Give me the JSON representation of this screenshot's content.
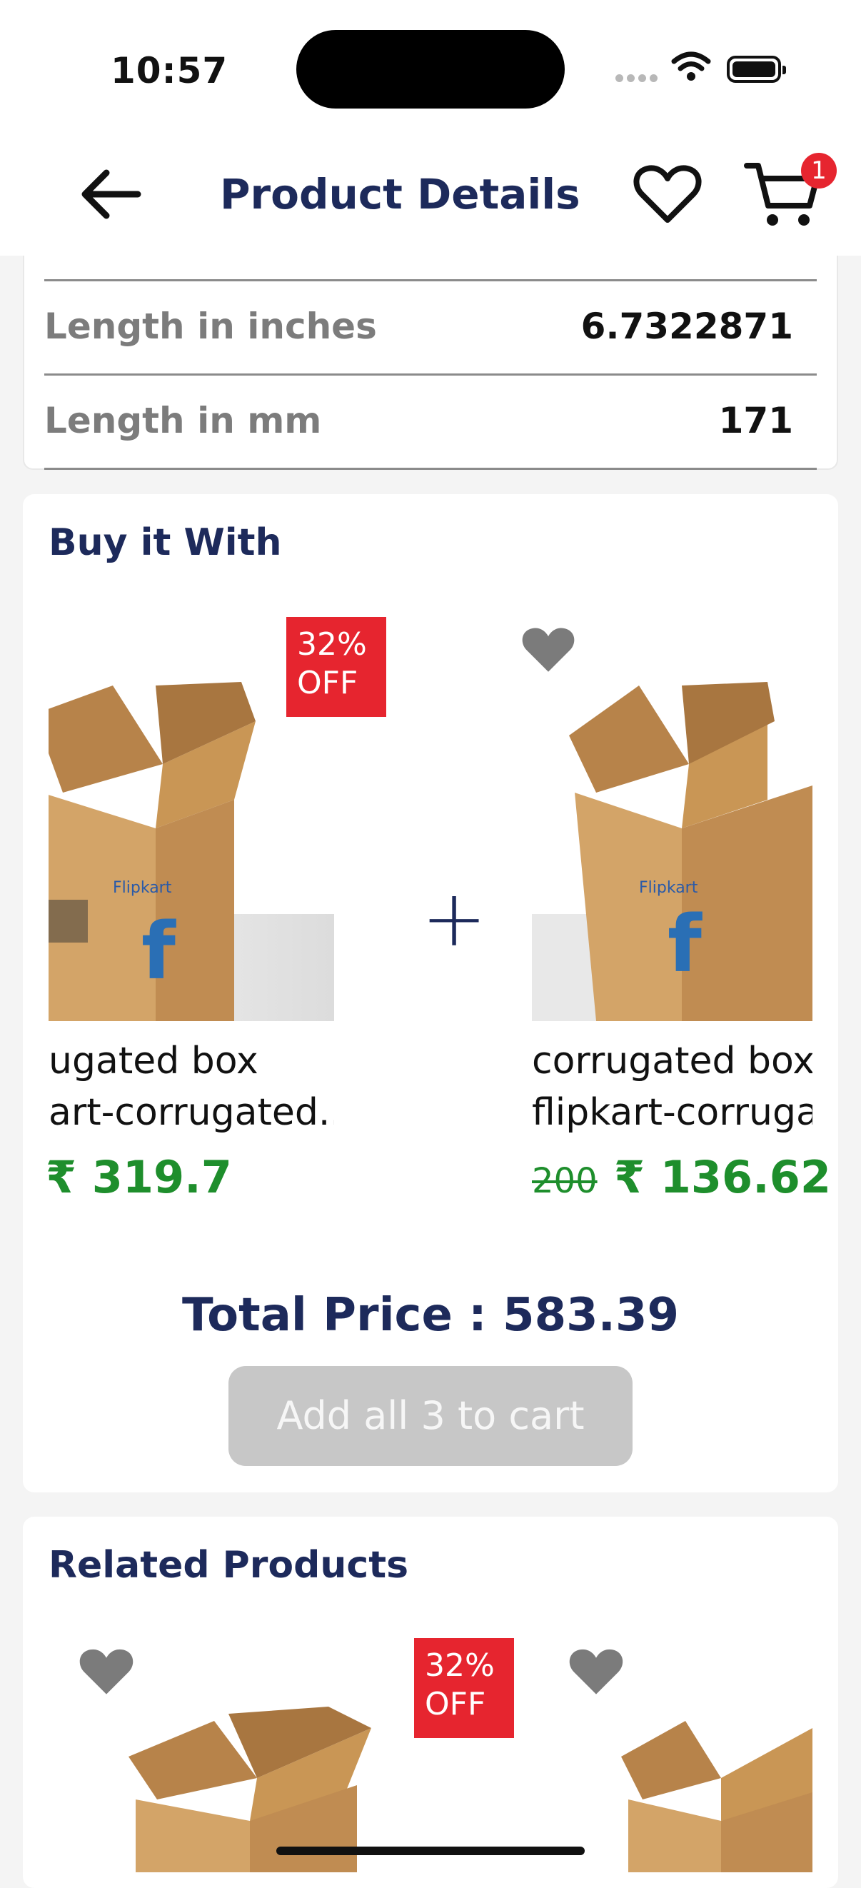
{
  "status_bar": {
    "time": "10:57"
  },
  "header": {
    "title": "Product Details",
    "cart_count": "1"
  },
  "specs": [
    {
      "label": "Length in inches",
      "value": "6.7322871"
    },
    {
      "label": "Length in mm",
      "value": "171"
    }
  ],
  "buy_it_with": {
    "title": "Buy it With",
    "items": [
      {
        "name_line1": "ugated box",
        "name_line2": "art-corrugated...",
        "price": "₹ 319.7",
        "discount": [
          "32%",
          "OFF"
        ]
      },
      {
        "name_line1": "corrugated box",
        "name_line2": "flipkart-corruga",
        "old_price": "200",
        "price": "₹ 136.62"
      }
    ],
    "total_price": "Total Price : 583.39",
    "add_button": "Add all 3 to cart"
  },
  "related_products": {
    "title": "Related Products",
    "items": [
      {
        "discount": [
          "32%",
          "OFF"
        ]
      },
      {}
    ]
  },
  "colors": {
    "accent_navy": "#1d2a5b",
    "price_green": "#1e8e2c",
    "badge_red": "#e6252f",
    "disabled_button": "#c7c7c7"
  }
}
